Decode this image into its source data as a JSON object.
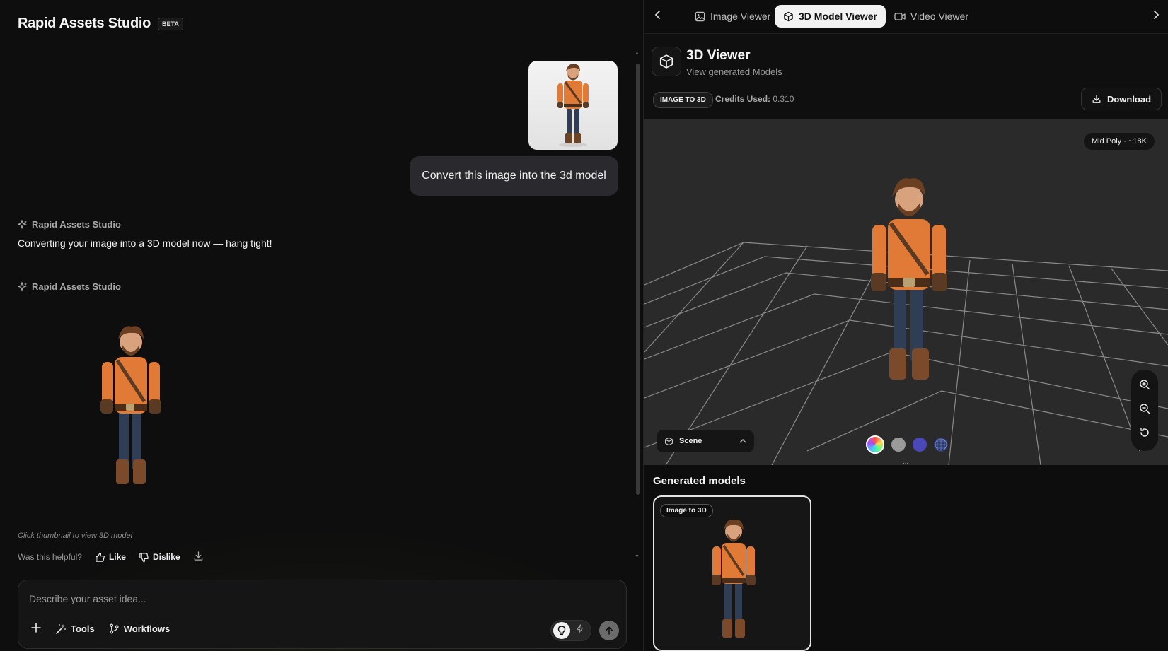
{
  "left": {
    "brand": {
      "title": "Rapid Assets Studio",
      "badge": "BETA"
    },
    "user_message": {
      "text": "Convert this image into the 3d model"
    },
    "bot_messages": [
      {
        "sender": "Rapid Assets Studio",
        "text": "Converting your image into a 3D model now — hang tight!"
      },
      {
        "sender": "Rapid Assets Studio"
      }
    ],
    "hint": "Click thumbnail to view 3D model",
    "feedback": {
      "question": "Was this helpful?",
      "like": "Like",
      "dislike": "Dislike"
    },
    "composer": {
      "placeholder": "Describe your asset idea...",
      "tools": "Tools",
      "workflows": "Workflows"
    }
  },
  "right": {
    "tabs": [
      {
        "label": "Image Viewer",
        "icon": "image-icon",
        "active": false
      },
      {
        "label": "3D Model Viewer",
        "icon": "cube-icon",
        "active": true
      },
      {
        "label": "Video Viewer",
        "icon": "video-icon",
        "active": false
      }
    ],
    "viewer": {
      "title": "3D Viewer",
      "subtitle": "View generated Models",
      "badge": "IMAGE TO 3D",
      "credits_label": "Credits Used:",
      "credits_value": "0.310",
      "download": "Download",
      "poly": "Mid Poly · ~18K",
      "scene": "Scene"
    },
    "swatches": [
      {
        "name": "rainbow-swatch",
        "color": "conic"
      },
      {
        "name": "gray-swatch",
        "color": "#9a9a9a"
      },
      {
        "name": "blue-swatch",
        "color": "#4a48b8"
      },
      {
        "name": "wireframe-swatch",
        "color": "#2c3a6b"
      }
    ],
    "generated": {
      "title": "Generated models",
      "items": [
        {
          "tag": "Image to 3D"
        }
      ]
    }
  },
  "colors": {
    "accent_orange": "#e07a36",
    "panel_bg": "#0e0e0e",
    "stage_bg": "#2a2a2a"
  }
}
